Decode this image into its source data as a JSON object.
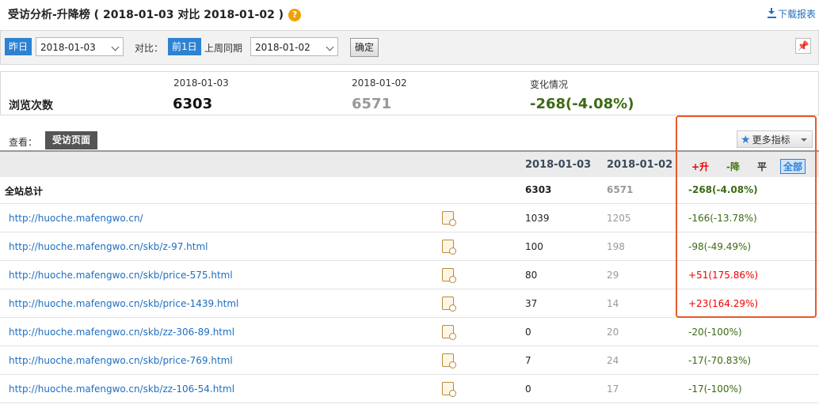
{
  "header": {
    "title": "受访分析-升降榜 ( 2018-01-03 对比 2018-01-02 )",
    "help_icon": "?",
    "download_label": "下载报表"
  },
  "toolbar": {
    "yesterday_label": "昨日",
    "date_value": "2018-01-03",
    "compare_label": "对比：",
    "prev_day_label": "前1日",
    "same_period_label": "上周同期",
    "compare_date_value": "2018-01-02",
    "confirm_label": "确定"
  },
  "summary": {
    "metric_label": "浏览次数",
    "date1": "2018-01-03",
    "value1": "6303",
    "date2": "2018-01-02",
    "value2": "6571",
    "change_label": "变化情况",
    "change_value": "-268(-4.08%)"
  },
  "view": {
    "label": "查看：",
    "active_tab": "受访页面",
    "more_metrics": "更多指标"
  },
  "table": {
    "col_date1": "2018-01-03",
    "col_date2": "2018-01-02",
    "filter_up": "+升",
    "filter_down": "-降",
    "filter_flat": "平",
    "filter_all": "全部",
    "total": {
      "label": "全站总计",
      "cur": "6303",
      "prev": "6571",
      "change": "-268(-4.08%)"
    },
    "rows": [
      {
        "url": "http://huoche.mafengwo.cn/",
        "cur": "1039",
        "prev": "1205",
        "change": "-166(-13.78%)"
      },
      {
        "url": "http://huoche.mafengwo.cn/skb/z-97.html",
        "cur": "100",
        "prev": "198",
        "change": "-98(-49.49%)"
      },
      {
        "url": "http://huoche.mafengwo.cn/skb/price-575.html",
        "cur": "80",
        "prev": "29",
        "change": "+51(175.86%)"
      },
      {
        "url": "http://huoche.mafengwo.cn/skb/price-1439.html",
        "cur": "37",
        "prev": "14",
        "change": "+23(164.29%)"
      },
      {
        "url": "http://huoche.mafengwo.cn/skb/zz-306-89.html",
        "cur": "0",
        "prev": "20",
        "change": "-20(-100%)"
      },
      {
        "url": "http://huoche.mafengwo.cn/skb/price-769.html",
        "cur": "7",
        "prev": "24",
        "change": "-17(-70.83%)"
      },
      {
        "url": "http://huoche.mafengwo.cn/skb/zz-106-54.html",
        "cur": "0",
        "prev": "17",
        "change": "-17(-100%)"
      }
    ]
  },
  "colors": {
    "accent": "#2d82d2",
    "increase": "#ee0000",
    "decrease": "#3d6a14",
    "highlight_box": "#e85a2a"
  }
}
